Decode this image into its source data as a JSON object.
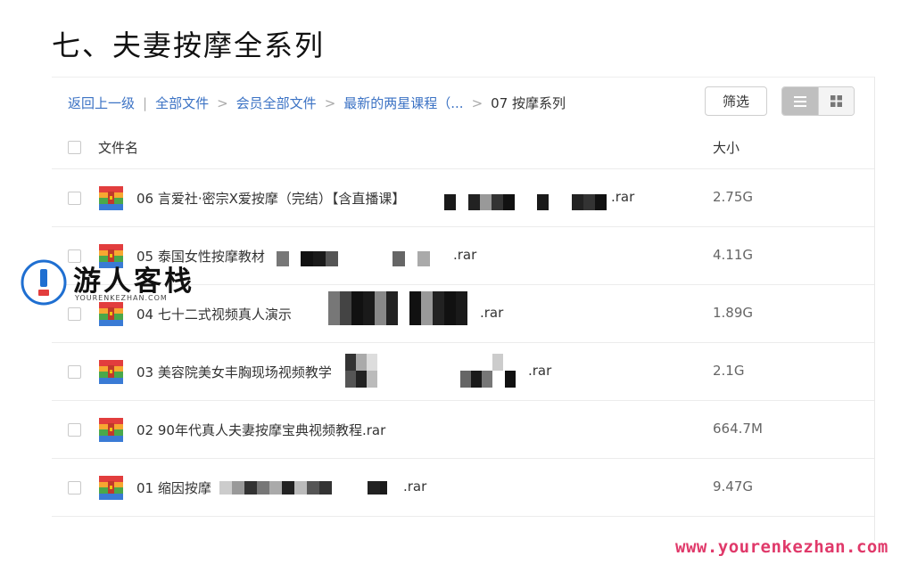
{
  "heading": "七、夫妻按摩全系列",
  "breadcrumb": {
    "back": "返回上一级",
    "divider": "|",
    "items": [
      "全部文件",
      "会员全部文件",
      "最新的两星课程（...",
      "07 按摩系列"
    ],
    "separator": ">"
  },
  "toolbar": {
    "filter_label": "筛选",
    "view_mode": "list"
  },
  "table": {
    "header_name": "文件名",
    "header_size": "大小"
  },
  "files": [
    {
      "name": "06 言爱社·密宗X爱按摩（完结）【含直播课】",
      "ext": ".rar",
      "size": "2.75G"
    },
    {
      "name": "05 泰国女性按摩教材",
      "ext": ".rar",
      "size": "4.11G"
    },
    {
      "name": "04 七十二式视频真人演示",
      "ext": ".rar",
      "size": "1.89G"
    },
    {
      "name": "03 美容院美女丰胸现场视频教学",
      "ext": ".rar",
      "size": "2.1G"
    },
    {
      "name": "02 90年代真人夫妻按摩宝典视频教程.rar",
      "ext": "",
      "size": "664.7M"
    },
    {
      "name": "01 缩因按摩",
      "ext": ".rar",
      "size": "9.47G"
    }
  ],
  "watermark": {
    "title": "游人客栈",
    "subtitle": "YOURENKEZHAN.COM",
    "url": "www.yourenkezhan.com"
  },
  "colors": {
    "link": "#3b72c4",
    "url_watermark": "#e0396a",
    "icon_red": "#e23d3d",
    "icon_orange": "#f7a731",
    "icon_green": "#4aa84a",
    "icon_blue": "#3a7bd5"
  }
}
